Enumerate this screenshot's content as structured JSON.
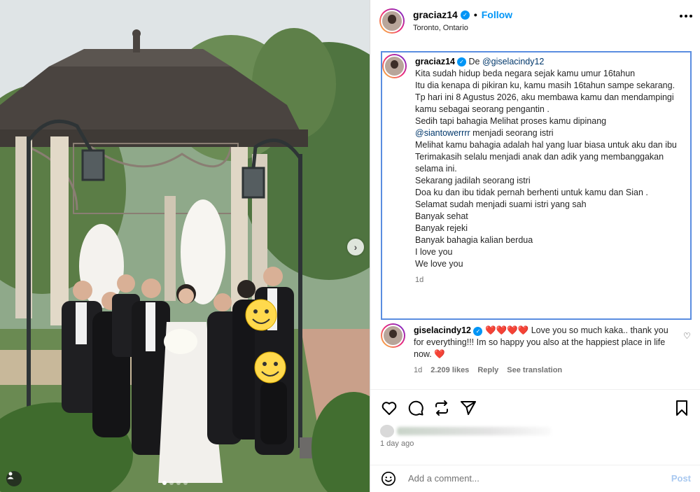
{
  "post": {
    "username": "graciaz14",
    "follow_label": "Follow",
    "location": "Toronto, Ontario",
    "separator": "•"
  },
  "caption": {
    "username": "graciaz14",
    "intro": "De",
    "intro_mention": "@giselacindy12",
    "lines": [
      "Kita sudah hidup beda negara sejak kamu umur 16tahun",
      "Itu dia kenapa di pikiran ku, kamu masih 16tahun sampe sekarang.",
      "Tp hari ini 8 Agustus 2026, aku membawa kamu dan mendampingi kamu sebagai seorang pengantin .",
      "Sedih tapi bahagia Melihat proses kamu dipinang",
      "menjadi seorang istri",
      "Melihat kamu bahagia adalah hal yang luar biasa untuk aku dan ibu",
      "Terimakasih selalu menjadi anak dan adik yang membanggakan selama ini.",
      "Sekarang jadilah seorang istri",
      "Doa ku dan ibu tidak pernah berhenti untuk kamu dan Sian .",
      "Selamat sudah menjadi suami istri yang sah",
      "Banyak sehat",
      "Banyak rejeki",
      "Banyak bahagia kalian berdua",
      "I love you",
      "We love you"
    ],
    "mention_2": "@siantowerrrr",
    "time": "1d"
  },
  "comment": {
    "username": "giselacindy12",
    "hearts": "❤️❤️❤️❤️",
    "text": "Love you so much kaka.. thank you for everything!!! Im so happy you also at the happiest place in life now.",
    "heart_end": "❤️",
    "time": "1d",
    "likes": "2.209 likes",
    "reply": "Reply",
    "translate": "See translation"
  },
  "footer": {
    "post_time": "1 day ago",
    "add_comment_placeholder": "Add a comment...",
    "post_label": "Post"
  },
  "icons": {
    "like": "heart-icon",
    "comment": "comment-icon",
    "repost": "repost-icon",
    "share": "share-icon",
    "save": "bookmark-icon",
    "emoji": "emoji-icon",
    "more": "more-icon",
    "next": "chevron-right-icon",
    "tag": "user-tag-icon"
  },
  "colors": {
    "accent": "#0095f6",
    "caption_highlight": "#5a8de0",
    "mention": "#00376b",
    "heart": "#e0245e"
  }
}
